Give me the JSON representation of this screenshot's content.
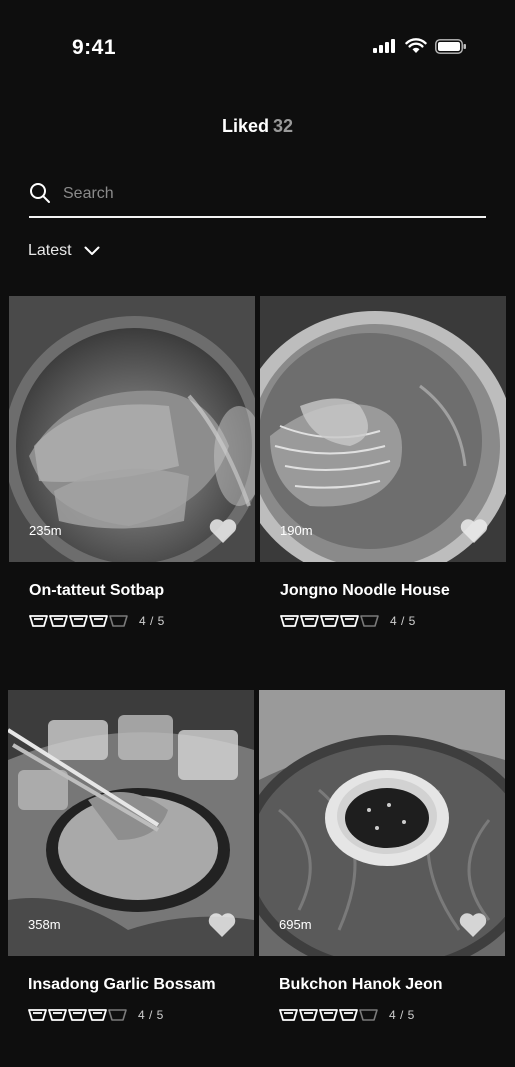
{
  "status": {
    "time": "9:41"
  },
  "header": {
    "title": "Liked",
    "count": "32"
  },
  "search": {
    "placeholder": "Search",
    "value": ""
  },
  "sort": {
    "label": "Latest"
  },
  "colors": {
    "background": "#0e0e0e",
    "text": "#ffffff",
    "muted": "#9a9a9a"
  },
  "cards": [
    {
      "name": "On-tatteut Sotbap",
      "distance": "235m",
      "rating_text": "4 / 5",
      "rating": 4
    },
    {
      "name": "Jongno Noodle House",
      "distance": "190m",
      "rating_text": "4 / 5",
      "rating": 4
    },
    {
      "name": "Insadong Garlic Bossam",
      "distance": "358m",
      "rating_text": "4 / 5",
      "rating": 4
    },
    {
      "name": "Bukchon Hanok Jeon",
      "distance": "695m",
      "rating_text": "4 / 5",
      "rating": 4
    }
  ]
}
